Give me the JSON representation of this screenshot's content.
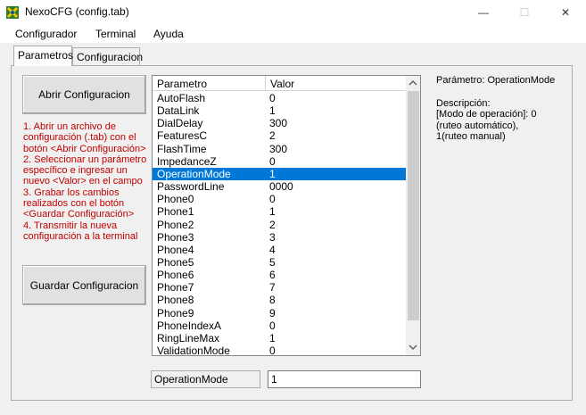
{
  "window": {
    "title": "NexoCFG (config.tab)",
    "minimize": "—",
    "maximize": "☐",
    "close": "✕"
  },
  "menu": [
    "Configurador",
    "Terminal",
    "Ayuda"
  ],
  "tabs": [
    "Parametros",
    "Configuracion"
  ],
  "buttons": {
    "open": "Abrir Configuracion",
    "save": "Guardar Configuracion"
  },
  "instructions": [
    "1. Abrir un archivo de configuración (.tab) con el botón <Abrir Configuración>",
    "2. Seleccionar un parámetro específico e ingresar un nuevo <Valor> en el campo",
    "3. Grabar los cambios realizados con el botón <Guardar Configuración>",
    "4. Transmitir la nueva configuración a la terminal"
  ],
  "table": {
    "columns": [
      "Parametro",
      "Valor"
    ],
    "rows": [
      [
        "AutoFlash",
        "0"
      ],
      [
        "DataLink",
        "1"
      ],
      [
        "DialDelay",
        "300"
      ],
      [
        "FeaturesC",
        "2"
      ],
      [
        "FlashTime",
        "300"
      ],
      [
        "ImpedanceZ",
        "0"
      ],
      [
        "OperationMode",
        "1"
      ],
      [
        "PasswordLine",
        "0000"
      ],
      [
        "Phone0",
        "0"
      ],
      [
        "Phone1",
        "1"
      ],
      [
        "Phone2",
        "2"
      ],
      [
        "Phone3",
        "3"
      ],
      [
        "Phone4",
        "4"
      ],
      [
        "Phone5",
        "5"
      ],
      [
        "Phone6",
        "6"
      ],
      [
        "Phone7",
        "7"
      ],
      [
        "Phone8",
        "8"
      ],
      [
        "Phone9",
        "9"
      ],
      [
        "PhoneIndexA",
        "0"
      ],
      [
        "RingLineMax",
        "1"
      ],
      [
        "ValidationMode",
        "0"
      ]
    ],
    "selected_row": "OperationMode"
  },
  "editor": {
    "name": "OperationMode",
    "value": "1"
  },
  "detail": {
    "param_label": "Parámetro: OperationMode",
    "desc_label": "Descripción:",
    "desc_text": "[Modo de operación]: 0 (ruteo automático), 1(ruteo manual)"
  },
  "colors": {
    "selection": "#0078d7",
    "instructions": "#c00000"
  }
}
